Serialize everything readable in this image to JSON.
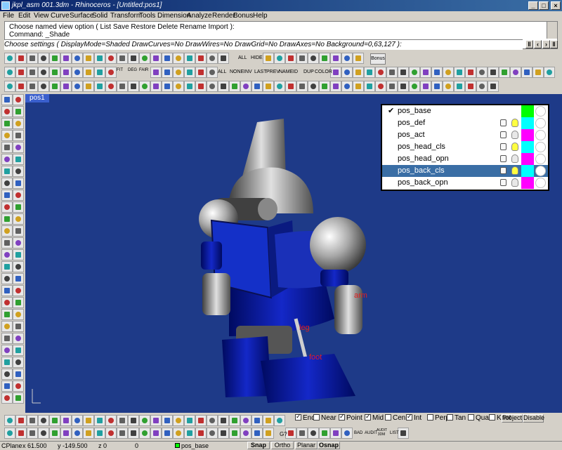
{
  "window": {
    "title": "jkpl_asm 001.3dm - Rhinoceros - [Untitled:pos1]"
  },
  "menu": [
    "File",
    "Edit",
    "View",
    "Curve",
    "Surface",
    "Solid",
    "Transform",
    "Tools",
    "Dimension",
    "Analyze",
    "Render",
    "Bonus",
    "Help"
  ],
  "command": {
    "line1": "Choose named view option ( List  Save  Restore  Delete  Rename  Import ):",
    "line2": "Command: _Shade",
    "prompt": "Choose settings ( DisplayMode=Shaded  DrawCurves=No  DrawWires=No  DrawGrid=No  DrawAxes=No  Background=0,63,127 ):"
  },
  "toolbar": {
    "bonus_label": "Bonus",
    "all_label": "ALL",
    "hide_label": "HIDE",
    "row2_labels": [
      "ALL",
      "NONE",
      "INV",
      "LAST",
      "PREV",
      "NAME",
      "ID",
      "DUP",
      "COLOR"
    ],
    "row2_labels2": [
      "FIT",
      "DEG",
      "FAIR"
    ]
  },
  "viewport": {
    "tab": "pos1",
    "labels": {
      "arm": "arm",
      "leg": "leg",
      "foot": "foot"
    },
    "background": "#1e3a88"
  },
  "layers": [
    {
      "name": "pos_base",
      "current": true,
      "color": "#00ff00",
      "selected": false
    },
    {
      "name": "pos_def",
      "current": false,
      "color": "#00ffff",
      "selected": false
    },
    {
      "name": "pos_act",
      "current": false,
      "color": "#ff00ff",
      "selected": false
    },
    {
      "name": "pos_head_cls",
      "current": false,
      "color": "#00ffff",
      "selected": false
    },
    {
      "name": "pos_head_opn",
      "current": false,
      "color": "#ff00ff",
      "selected": false
    },
    {
      "name": "pos_back_cls",
      "current": false,
      "color": "#00ffff",
      "selected": true
    },
    {
      "name": "pos_back_opn",
      "current": false,
      "color": "#ff00ff",
      "selected": false
    }
  ],
  "osnap": [
    {
      "label": "End",
      "checked": true
    },
    {
      "label": "Near",
      "checked": false
    },
    {
      "label": "Point",
      "checked": true
    },
    {
      "label": "Mid",
      "checked": true
    },
    {
      "label": "Cen",
      "checked": false
    },
    {
      "label": "Int",
      "checked": true
    },
    {
      "label": "Perp",
      "checked": false
    },
    {
      "label": "Tan",
      "checked": false
    },
    {
      "label": "Quad",
      "checked": false
    },
    {
      "label": "Knot",
      "checked": false
    }
  ],
  "osnap_buttons": {
    "project": "Project",
    "disable": "Disable"
  },
  "bottom_labels": {
    "bad": "BAD",
    "audit": "AUDIT",
    "audit3dm": "AUDIT 3DM",
    "list": "LIST",
    "g": "G?"
  },
  "status": {
    "plane": "CPlane",
    "x": "x 61.500",
    "y": "y -149.500",
    "z": "z 0",
    "extra": "0",
    "layer": "pos_base",
    "snap": "Snap",
    "ortho": "Ortho",
    "planar": "Planar",
    "osnap": "Osnap"
  }
}
